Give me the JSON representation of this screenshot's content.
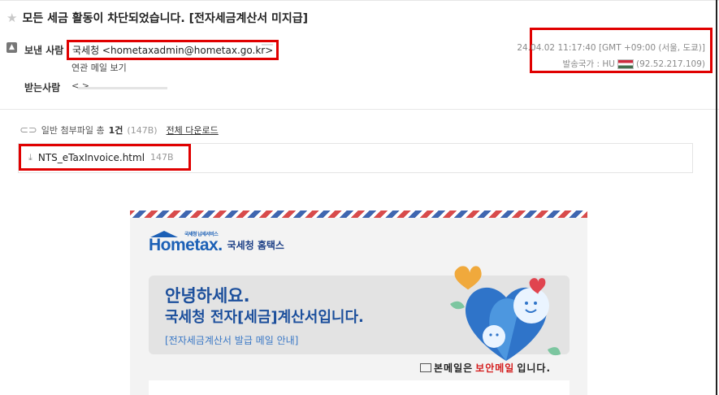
{
  "subject": "모든 세금 활동이 차단되었습니다. [전자세금계산서 미지급]",
  "sender": {
    "label": "보낸 사람",
    "value": "국세청 <hometaxadmin@hometax.go.kr>",
    "related_mail": "연관 메일 보기"
  },
  "recipient": {
    "label": "받는사람",
    "value": "<                                        >"
  },
  "meta": {
    "datetime": "24.04.02 11:17:40 [GMT +09:00 (서울, 도쿄)]",
    "country_label": "발송국가 : HU",
    "ip": "(92.52.217.109)"
  },
  "attachments": {
    "header_prefix": "일반 첨부파일 총",
    "count": "1건",
    "total_size": "(147B)",
    "download_all": "전체 다운로드",
    "files": [
      {
        "name": "NTS_eTaxInvoice.html",
        "size": "147B"
      }
    ]
  },
  "body": {
    "logo_text": "Hometax.",
    "logo_small": "국세청 납세서비스",
    "logo_kr": "국세청 홈택스",
    "greeting": "안녕하세요.",
    "title": "국세청 전자[세금]계산서입니다.",
    "guide": "[전자세금계산서 발급 메일 안내]",
    "secure_prefix": "본메일은",
    "secure_red": "보안메일",
    "secure_suffix": "입니다."
  },
  "colors": {
    "highlight": "#e00000",
    "brand": "#1c60b6"
  }
}
